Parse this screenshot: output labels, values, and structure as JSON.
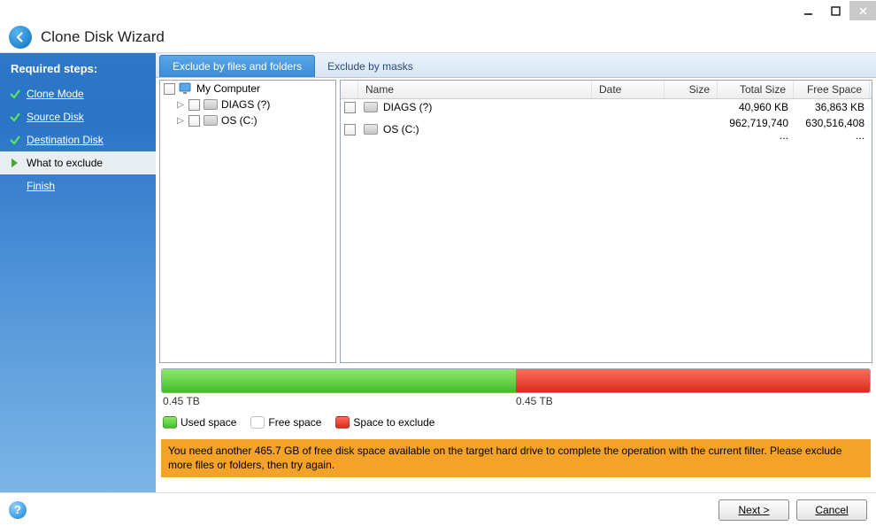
{
  "window": {
    "title": "Clone Disk Wizard"
  },
  "sidebar": {
    "heading": "Required steps:",
    "steps": [
      {
        "label": "Clone Mode",
        "state": "done"
      },
      {
        "label": "Source Disk",
        "state": "done"
      },
      {
        "label": "Destination Disk",
        "state": "done"
      },
      {
        "label": "What to exclude",
        "state": "active"
      },
      {
        "label": "Finish",
        "state": "future"
      }
    ]
  },
  "tabs": [
    {
      "label": "Exclude by files and folders",
      "active": true
    },
    {
      "label": "Exclude by masks",
      "active": false
    }
  ],
  "tree": {
    "root": "My Computer",
    "children": [
      {
        "label": "DIAGS (?)"
      },
      {
        "label": "OS (C:)"
      }
    ]
  },
  "list": {
    "columns": {
      "name": "Name",
      "date": "Date",
      "size": "Size",
      "total": "Total Size",
      "free": "Free Space"
    },
    "rows": [
      {
        "name": "DIAGS (?)",
        "date": "",
        "size": "",
        "total": "40,960 KB",
        "free": "36,863 KB"
      },
      {
        "name": "OS (C:)",
        "date": "",
        "size": "",
        "total": "962,719,740 ...",
        "free": "630,516,408 ..."
      }
    ]
  },
  "capacity": {
    "used_pct": 50,
    "exclude_pct": 50,
    "used_label": "0.45 TB",
    "exclude_label": "0.45 TB"
  },
  "legend": {
    "used": "Used space",
    "free": "Free space",
    "exclude": "Space to exclude"
  },
  "warning": "You need another 465.7 GB of free disk space available on the target hard drive to complete the operation with the current filter. Please exclude more files or folders, then try again.",
  "buttons": {
    "next": "Next >",
    "cancel": "Cancel"
  },
  "colors": {
    "used": "#4fca33",
    "free": "#ffffff",
    "exclude": "#e2362a",
    "warning_bg": "#f4a228"
  }
}
